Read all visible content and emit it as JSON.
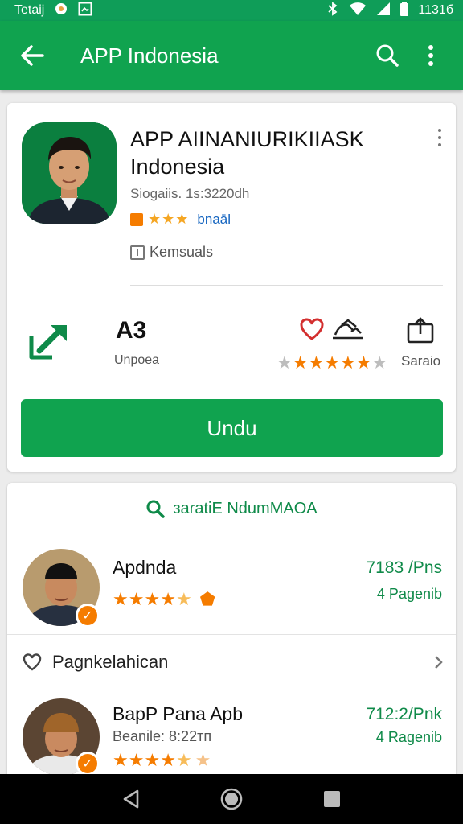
{
  "status_bar": {
    "left_text": "Tetaіј",
    "time": "1131б"
  },
  "app_bar": {
    "title": "APP Indonesia"
  },
  "app": {
    "name": "APP AIINANIURIKIIASK Indonesia",
    "meta": "Siogaiis. 1s:3220dh",
    "rating_link": "bnaāl",
    "category": "Kemsuals"
  },
  "stats": {
    "value": "A3",
    "value_label": "Unpoea",
    "rating_stars": 6,
    "rating_total": 7,
    "share_label": "Saraio"
  },
  "install_button": {
    "label": "Undu"
  },
  "search_link": {
    "label": "зaratiE NdumMAOA"
  },
  "list": {
    "items": [
      {
        "name": "Apdnda",
        "stars": 4.5,
        "price": "7183 /Pns",
        "count": "4 Pagenib"
      },
      {
        "name": "BapP Pana Apb",
        "sub": "Beanile: 8:22тп",
        "stars": 4.5,
        "price": "712:2/Pnk",
        "count": "4 Ragenib"
      }
    ],
    "section_label": "Pagnkelahican"
  },
  "colors": {
    "primary": "#10a34f",
    "accent": "#f57c00",
    "link": "#1565c0"
  }
}
